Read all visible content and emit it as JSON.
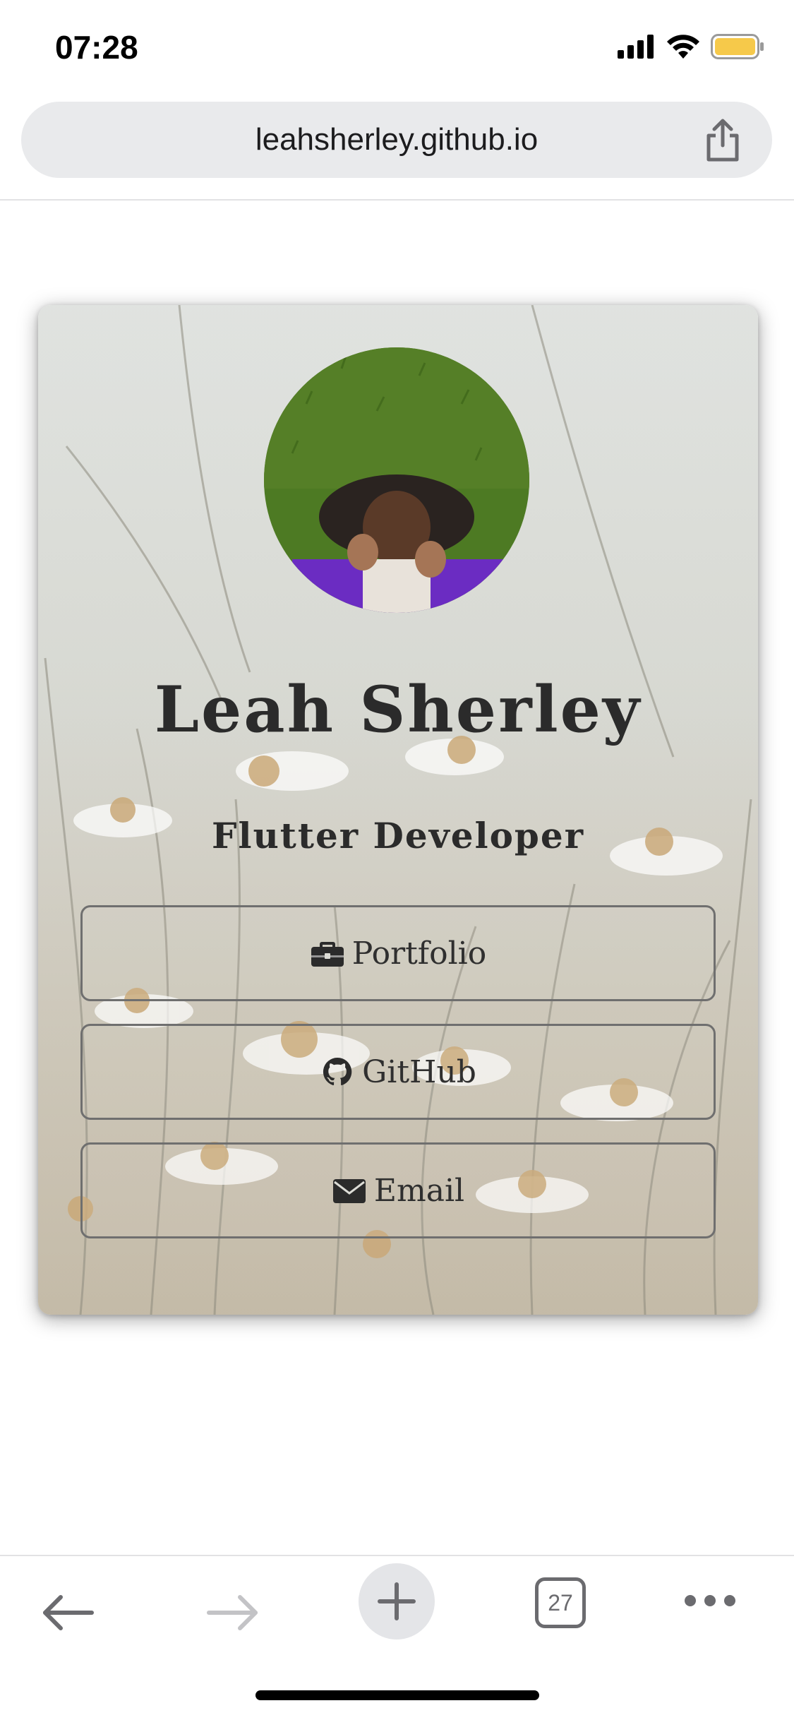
{
  "status_bar": {
    "time": "07:28",
    "icons": [
      "signal-icon",
      "wifi-icon",
      "battery-icon"
    ],
    "battery_color": "#f6c94a"
  },
  "browser": {
    "url": "leahsherley.github.io",
    "share_icon": "share-icon"
  },
  "profile": {
    "name": "Leah Sherley",
    "role": "Flutter Developer",
    "links": [
      {
        "label": "Portfolio",
        "icon": "briefcase-icon"
      },
      {
        "label": "GitHub",
        "icon": "github-icon"
      },
      {
        "label": "Email",
        "icon": "envelope-icon"
      }
    ]
  },
  "toolbar": {
    "tab_count": "27",
    "buttons": [
      "back-icon",
      "forward-icon",
      "plus-icon",
      "tabs-icon",
      "more-icon"
    ]
  },
  "colors": {
    "url_bar_bg": "#e9eaec",
    "text_dark": "#2b2b2b",
    "button_border": "#6f6f6f",
    "toolbar_icon": "#6b6b6f"
  }
}
